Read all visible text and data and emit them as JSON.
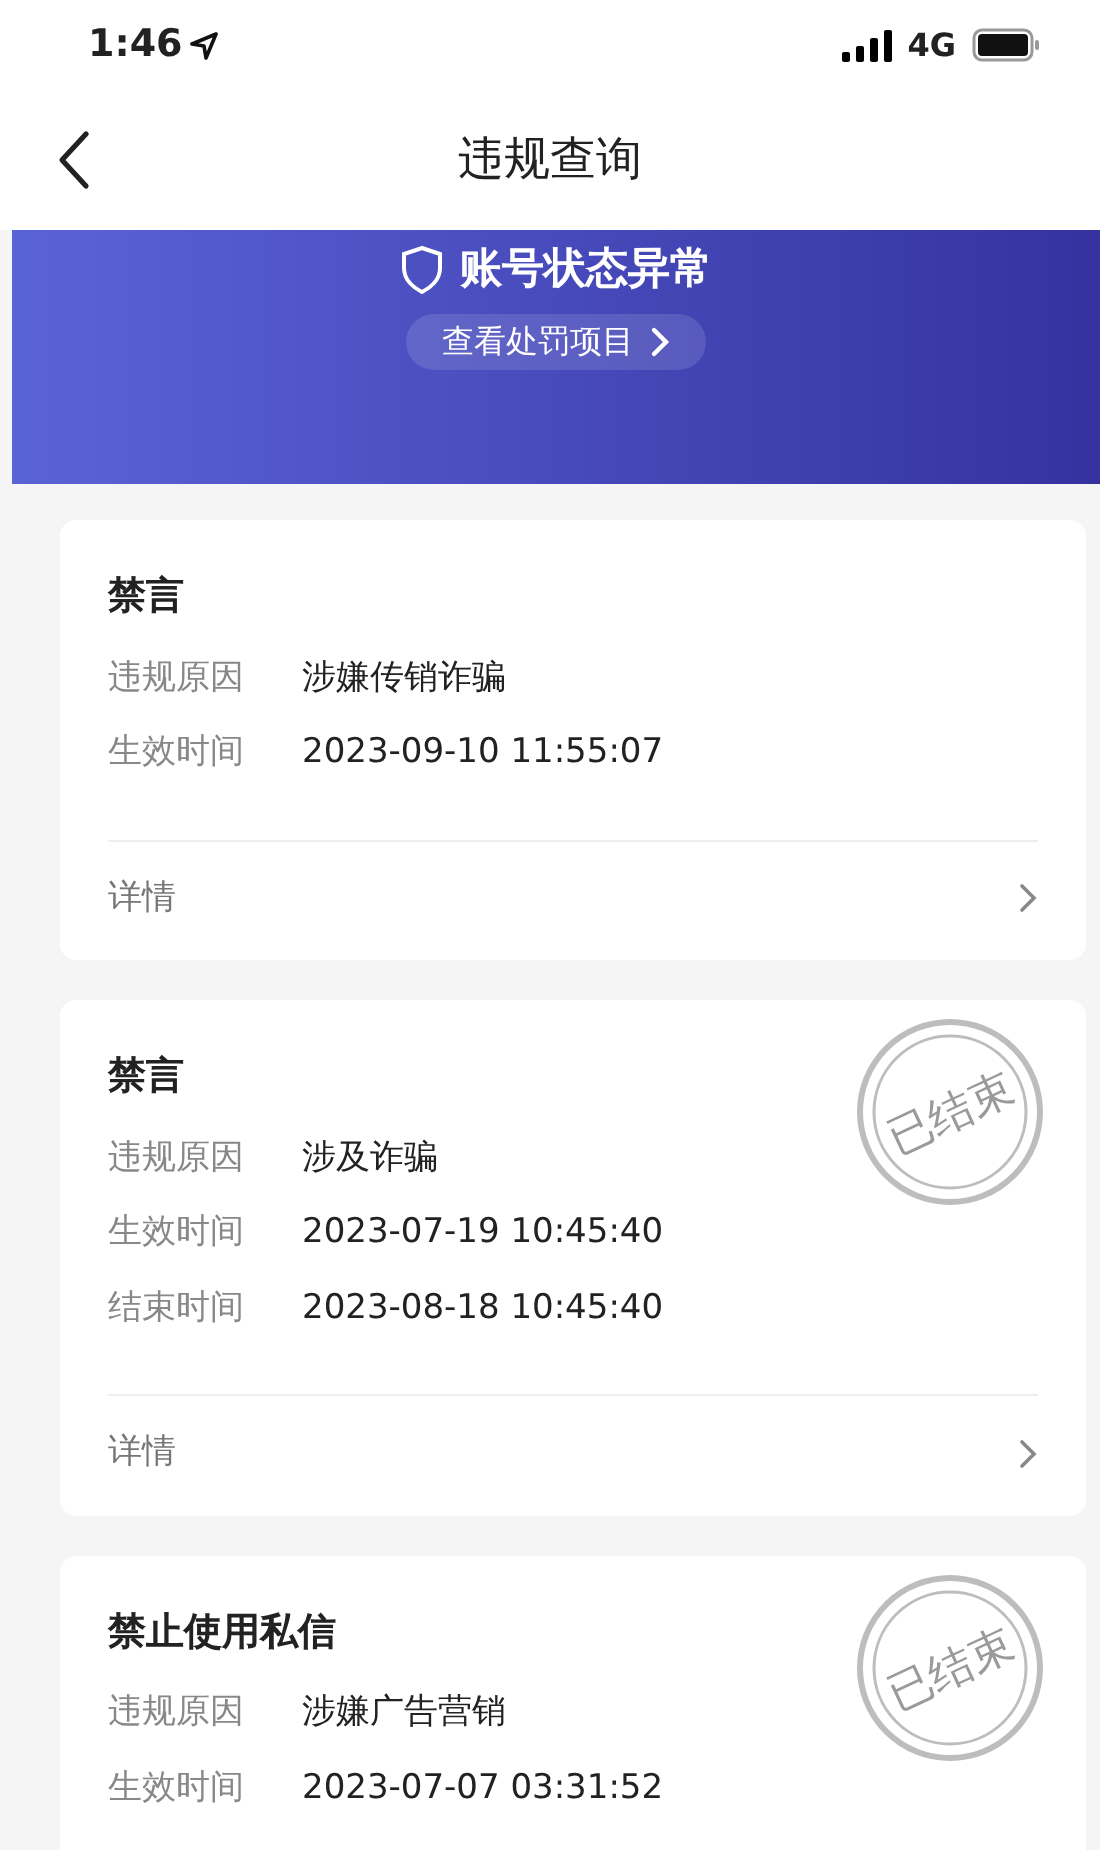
{
  "status_bar": {
    "time": "1:46",
    "network": "4G"
  },
  "nav": {
    "title": "违规查询"
  },
  "banner": {
    "heading": "账号状态异常",
    "button": "查看处罚项目"
  },
  "records": [
    {
      "title": "禁言",
      "fields": [
        {
          "label": "违规原因",
          "value": "涉嫌传销诈骗"
        },
        {
          "label": "生效时间",
          "value": "2023-09-10 11:55:07"
        }
      ],
      "link": "详情"
    },
    {
      "title": "禁言",
      "stamp": "已结束",
      "fields": [
        {
          "label": "违规原因",
          "value": "涉及诈骗"
        },
        {
          "label": "生效时间",
          "value": "2023-07-19 10:45:40"
        },
        {
          "label": "结束时间",
          "value": "2023-08-18 10:45:40"
        }
      ],
      "link": "详情"
    },
    {
      "title": "禁止使用私信",
      "stamp": "已结束",
      "fields": [
        {
          "label": "违规原因",
          "value": "涉嫌广告营销"
        },
        {
          "label": "生效时间",
          "value": "2023-07-07 03:31:52"
        }
      ]
    }
  ]
}
